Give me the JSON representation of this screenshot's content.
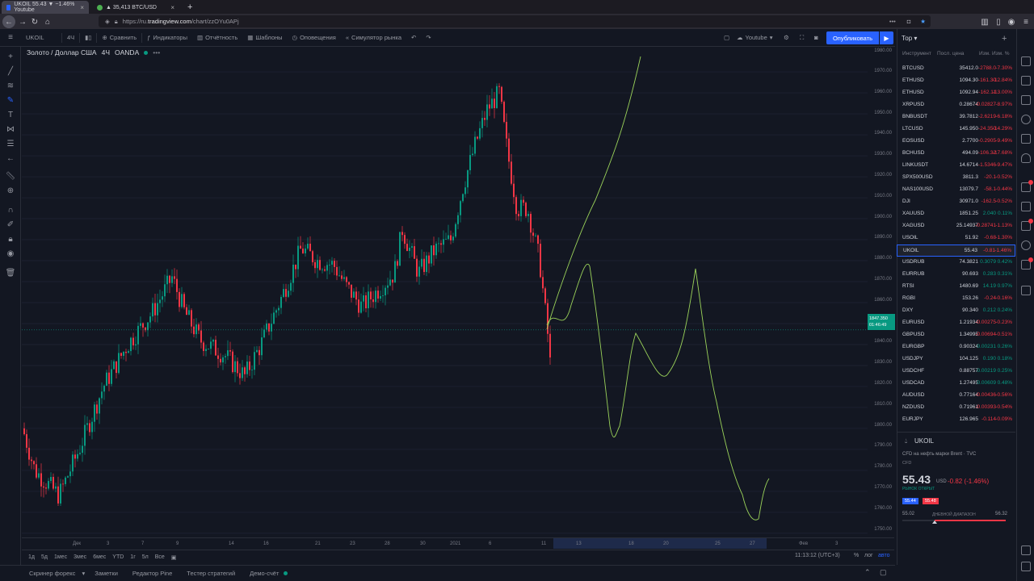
{
  "browser": {
    "tabs": [
      {
        "title": "UKOIL 55.43 ▼ −1.46% Youtube",
        "active": true
      },
      {
        "title": "▲ 35,413 BTC/USD",
        "active": false
      }
    ],
    "new_tab": "+",
    "url_prefix": "https://ru.",
    "url_host": "tradingview.com",
    "url_path": "/chart/zzOYu0APj"
  },
  "toolbar": {
    "symbol": "UKOIL",
    "interval": "4Ч",
    "compare": "Сравнить",
    "indicators": "Индикаторы",
    "financials": "Отчётность",
    "templates": "Шаблоны",
    "alerts": "Оповещения",
    "replay": "Симулятор рынка",
    "layout_name": "Youtube",
    "publish": "Опубликовать"
  },
  "chart": {
    "legend": {
      "title": "Золото / Доллар США",
      "interval": "4Ч",
      "source": "OANDA",
      "more": "•••"
    },
    "price_labels": [
      "1970.00",
      "1960.00",
      "1950.00",
      "1940.00",
      "1930.00",
      "1920.00",
      "1910.00",
      "1900.00",
      "1890.00",
      "1880.00",
      "1870.00",
      "1860.00",
      "1850.00",
      "1840.00",
      "1830.00",
      "1820.00",
      "1810.00",
      "1800.00",
      "1790.00",
      "1780.00",
      "1770.00",
      "1760.00",
      "1750.00"
    ],
    "price_top": "1980.00",
    "current_price": "1847.350",
    "current_time": "01:46:49",
    "time_labels": [
      "Дек",
      "3",
      "7",
      "9",
      "14",
      "16",
      "21",
      "23",
      "28",
      "30",
      "2021",
      "6",
      "11",
      "13",
      "18",
      "20",
      "25",
      "27",
      "Фев",
      "3"
    ],
    "colors": {
      "up": "#089981",
      "down": "#f23645",
      "drawing": "#9bd35a"
    }
  },
  "bottombar": {
    "ranges": [
      "1д",
      "5д",
      "1мес",
      "3мес",
      "6мес",
      "YTD",
      "1г",
      "5л",
      "Все"
    ],
    "clock": "11:13:12 (UTC+3)",
    "percent": "%",
    "log": "лог",
    "auto": "авто"
  },
  "footer": {
    "tabs": [
      "Скринер форекс",
      "Заметки",
      "Редактор Pine",
      "Тестер стратегий",
      "Демо-счёт"
    ]
  },
  "watchlist": {
    "title": "Тор",
    "columns": {
      "symbol": "Инструмент",
      "last": "Посл. цена",
      "change": "Изм.",
      "pct": "Изм. %"
    },
    "rows": [
      {
        "sym": "BTCUSD",
        "last": "35412.0",
        "chg": "-2788.0",
        "pct": "-7.30%",
        "dir": "neg"
      },
      {
        "sym": "ETHUSD",
        "last": "1094.30",
        "chg": "-161.30",
        "pct": "-12.84%",
        "dir": "neg"
      },
      {
        "sym": "ETHUSD",
        "last": "1092.94",
        "chg": "-162.11",
        "pct": "-13.00%",
        "dir": "neg"
      },
      {
        "sym": "XRPUSD",
        "last": "0.28674",
        "chg": "-0.02827",
        "pct": "-8.97%",
        "dir": "neg"
      },
      {
        "sym": "BNBUSDT",
        "last": "39.7812",
        "chg": "-2.6219",
        "pct": "-6.18%",
        "dir": "neg"
      },
      {
        "sym": "LTCUSD",
        "last": "145.950",
        "chg": "-24.350",
        "pct": "-14.29%",
        "dir": "neg"
      },
      {
        "sym": "EOSUSD",
        "last": "2.7700",
        "chg": "-0.2905",
        "pct": "-9.49%",
        "dir": "neg"
      },
      {
        "sym": "BCHUSD",
        "last": "494.09",
        "chg": "-106.32",
        "pct": "-17.68%",
        "dir": "neg"
      },
      {
        "sym": "LINKUSDT",
        "last": "14.6714",
        "chg": "-1.5346",
        "pct": "-9.47%",
        "dir": "neg"
      },
      {
        "sym": "SPX500USD",
        "last": "3811.3",
        "chg": "-20.1",
        "pct": "-0.52%",
        "dir": "neg"
      },
      {
        "sym": "NAS100USD",
        "last": "13079.7",
        "chg": "-58.1",
        "pct": "-0.44%",
        "dir": "neg"
      },
      {
        "sym": "DJI",
        "last": "30971.0",
        "chg": "-162.5",
        "pct": "-0.52%",
        "dir": "neg"
      },
      {
        "sym": "XAUUSD",
        "last": "1851.25",
        "chg": "2.040",
        "pct": "0.11%",
        "dir": "pos"
      },
      {
        "sym": "XAGUSD",
        "last": "25.14937",
        "chg": "-0.28741",
        "pct": "-1.13%",
        "dir": "neg"
      },
      {
        "sym": "USOIL",
        "last": "51.92",
        "chg": "-0.68",
        "pct": "-1.30%",
        "dir": "neg"
      },
      {
        "sym": "UKOIL",
        "last": "55.43",
        "chg": "-0.81",
        "pct": "-1.46%",
        "dir": "neg",
        "selected": true
      },
      {
        "sym": "USDRUB",
        "last": "74.3821",
        "chg": "0.3079",
        "pct": "0.42%",
        "dir": "pos"
      },
      {
        "sym": "EURRUB",
        "last": "90.693",
        "chg": "0.283",
        "pct": "0.31%",
        "dir": "pos"
      },
      {
        "sym": "RTSI",
        "last": "1480.69",
        "chg": "14.19",
        "pct": "0.97%",
        "dir": "pos"
      },
      {
        "sym": "RGBI",
        "last": "153.26",
        "chg": "-0.24",
        "pct": "-0.16%",
        "dir": "neg"
      },
      {
        "sym": "DXY",
        "last": "90.340",
        "chg": "0.212",
        "pct": "0.24%",
        "dir": "pos"
      },
      {
        "sym": "EURUSD",
        "last": "1.21934",
        "chg": "-0.00275",
        "pct": "-0.23%",
        "dir": "neg"
      },
      {
        "sym": "GBPUSD",
        "last": "1.34995",
        "chg": "-0.00694",
        "pct": "-0.51%",
        "dir": "neg"
      },
      {
        "sym": "EURGBP",
        "last": "0.90324",
        "chg": "0.00231",
        "pct": "0.26%",
        "dir": "pos"
      },
      {
        "sym": "USDJPY",
        "last": "104.125",
        "chg": "0.190",
        "pct": "0.18%",
        "dir": "pos"
      },
      {
        "sym": "USDCHF",
        "last": "0.88757",
        "chg": "0.00219",
        "pct": "0.25%",
        "dir": "pos"
      },
      {
        "sym": "USDCAD",
        "last": "1.27495",
        "chg": "0.00609",
        "pct": "0.48%",
        "dir": "pos"
      },
      {
        "sym": "AUDUSD",
        "last": "0.77164",
        "chg": "-0.00436",
        "pct": "-0.56%",
        "dir": "neg"
      },
      {
        "sym": "NZDUSD",
        "last": "0.71961",
        "chg": "-0.00393",
        "pct": "-0.54%",
        "dir": "neg"
      },
      {
        "sym": "EURJPY",
        "last": "126.965",
        "chg": "-0.114",
        "pct": "-0.09%",
        "dir": "neg"
      }
    ]
  },
  "details": {
    "symbol": "UKOIL",
    "description": "CFD на нефть марки Brent",
    "exchange": "TVC",
    "type": "CFD",
    "price": "55.43",
    "currency": "USD",
    "change": "-0.82 (-1.46%)",
    "status": "РЫНОК ОТКРЫТ",
    "bid": "55.44",
    "ask": "55.48",
    "low": "55.02",
    "range_label": "ДНЕВНОЙ ДИАПАЗОН",
    "high": "56.32"
  }
}
